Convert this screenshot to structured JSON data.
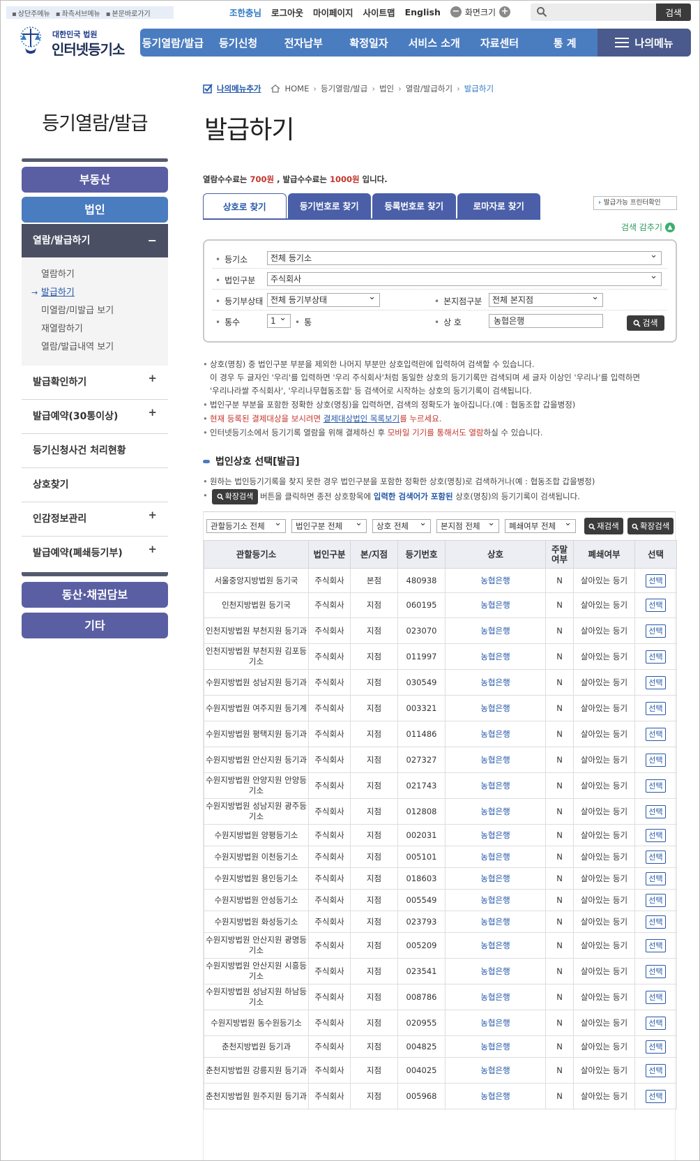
{
  "skipnav": [
    "상단주메뉴",
    "좌측서브메뉴",
    "본문바로가기"
  ],
  "util": {
    "user": "조한충님",
    "logout": "로그아웃",
    "mypage": "마이페이지",
    "sitemap": "사이트맵",
    "english": "English",
    "zoom": "화면크기",
    "search_btn": "검색"
  },
  "logo": {
    "sub": "대한민국 법원",
    "main": "인터넷등기소"
  },
  "gnb": [
    "등기열람/발급",
    "등기신청",
    "전자납부",
    "확정일자",
    "서비스 소개",
    "자료센터",
    "통 계"
  ],
  "mymenu": "나의메뉴",
  "breadcrumb": {
    "add": "나의메뉴추가",
    "items": [
      "HOME",
      "등기열람/발급",
      "법인",
      "열람/발급하기",
      "발급하기"
    ]
  },
  "page_title": "발급하기",
  "lnb": {
    "title": "등기열람/발급",
    "top_buttons": [
      "부동산",
      "법인"
    ],
    "sub_title": "열람/발급하기",
    "sub_items": [
      "열람하기",
      "발급하기",
      "미열람/미발급 보기",
      "재열람하기",
      "열람/발급내역 보기"
    ],
    "menus": [
      {
        "label": "발급확인하기",
        "expand": "+"
      },
      {
        "label": "발급예약(30통이상)",
        "expand": "+"
      },
      {
        "label": "등기신청사건 처리현황",
        "expand": ""
      },
      {
        "label": "상호찾기",
        "expand": ""
      },
      {
        "label": "인감정보관리",
        "expand": "+"
      },
      {
        "label": "발급예약(폐쇄등기부)",
        "expand": "+"
      }
    ],
    "bottom_buttons": [
      "동산·채권담보",
      "기타"
    ]
  },
  "fee": {
    "prefix": "열람수수료는 ",
    "view_fee": "700원",
    "mid": " , 발급수수료는 ",
    "issue_fee": "1000원",
    "suffix": " 입니다."
  },
  "tabs": [
    "상호로 찾기",
    "등기번호로 찾기",
    "등록번호로 찾기",
    "로마자로 찾기"
  ],
  "print_check": "발급가능 프린터확인",
  "fold": "검색 감추기",
  "search": {
    "registry_label": "등기소",
    "registry_value": "전체 등기소",
    "corp_type_label": "법인구분",
    "corp_type_value": "주식회사",
    "status_label": "등기부상태",
    "status_value": "전체 등기부상태",
    "branch_label": "본지점구분",
    "branch_value": "전체 본지점",
    "copies_label": "통수",
    "copies_value": "1",
    "copies_unit": "통",
    "name_label": "상 호",
    "name_value": "농협은행",
    "go": "검색"
  },
  "notes": {
    "n1a": "상호(명칭) 중 법인구분 부분을 제외한 나머지 부분만 상호입력란에 입력하여 검색할 수 있습니다.",
    "n1b": "이 경우 두 글자인 '우리'를 입력하면 '우리 주식회사'처럼 동일한 상호의 등기기록만 검색되며 세 글자 이상인 '우리나'를 입력하면",
    "n1c": "'우리나라쌀 주식회사', '우리나무협동조합' 등 검색어로 시작하는 상호의 등기기록이 검색됩니다.",
    "n2": "법인구분 부분을 포함한 정확한 상호(명칭)을 입력하면, 검색의 정확도가 높아집니다.(예 : 협동조합 갑을병정)",
    "n3a": "현재 등록된 결제대상을 보시려면 ",
    "n3b": "결제대상법인 목록보기",
    "n3c": "를 누르세요.",
    "n4a": "인터넷등기소에서 등기기록 열람을 위해 결제하신 후 ",
    "n4b": "모바일 기기를 통해서도 열람",
    "n4c": "하실 수 있습니다."
  },
  "section_title": "법인상호 선택[발급]",
  "notes2": {
    "m1": "원하는 법인등기기록을 찾지 못한 경우 법인구분을 포함한 정확한 상호(명칭)로 검색하거나(예 : 협동조합 갑을병정)",
    "m2_btn": "확장검색",
    "m2a": "버튼을 클릭하면 종전 상호항목에 ",
    "m2b": "입력한 검색어가 포함된",
    "m2c": " 상호(명칭)의 등기기록이 검색됩니다."
  },
  "filters": [
    "관할등기소 전체",
    "법인구분 전체",
    "상호 전체",
    "본지점 전체",
    "폐쇄여부 전체"
  ],
  "filter_buttons": {
    "research": "재검색",
    "expand": "확장검색"
  },
  "table": {
    "headers": [
      "관할등기소",
      "법인구분",
      "본/지점",
      "등기번호",
      "상호",
      "주말\n여부",
      "폐쇄여부",
      "선택"
    ],
    "select_label": "선택",
    "rows": [
      [
        "서울중앙지방법원 등기국",
        "주식회사",
        "본점",
        "480938",
        "농협은행",
        "N",
        "살아있는 등기"
      ],
      [
        "인천지방법원 등기국",
        "주식회사",
        "지점",
        "060195",
        "농협은행",
        "N",
        "살아있는 등기"
      ],
      [
        "인천지방법원 부천지원 등기과",
        "주식회사",
        "지점",
        "023070",
        "농협은행",
        "N",
        "살아있는 등기"
      ],
      [
        "인천지방법원 부천지원 김포등기소",
        "주식회사",
        "지점",
        "011997",
        "농협은행",
        "N",
        "살아있는 등기"
      ],
      [
        "수원지방법원 성남지원 등기과",
        "주식회사",
        "지점",
        "030549",
        "농협은행",
        "N",
        "살아있는 등기"
      ],
      [
        "수원지방법원 여주지원 등기계",
        "주식회사",
        "지점",
        "003321",
        "농협은행",
        "N",
        "살아있는 등기"
      ],
      [
        "수원지방법원 평택지원 등기과",
        "주식회사",
        "지점",
        "011486",
        "농협은행",
        "N",
        "살아있는 등기"
      ],
      [
        "수원지방법원 안산지원 등기과",
        "주식회사",
        "지점",
        "027327",
        "농협은행",
        "N",
        "살아있는 등기"
      ],
      [
        "수원지방법원 안양지원 안양등기소",
        "주식회사",
        "지점",
        "021743",
        "농협은행",
        "N",
        "살아있는 등기"
      ],
      [
        "수원지방법원 성남지원 광주등기소",
        "주식회사",
        "지점",
        "012808",
        "농협은행",
        "N",
        "살아있는 등기"
      ],
      [
        "수원지방법원 양평등기소",
        "주식회사",
        "지점",
        "002031",
        "농협은행",
        "N",
        "살아있는 등기"
      ],
      [
        "수원지방법원 이천등기소",
        "주식회사",
        "지점",
        "005101",
        "농협은행",
        "N",
        "살아있는 등기"
      ],
      [
        "수원지방법원 용인등기소",
        "주식회사",
        "지점",
        "018603",
        "농협은행",
        "N",
        "살아있는 등기"
      ],
      [
        "수원지방법원 안성등기소",
        "주식회사",
        "지점",
        "005549",
        "농협은행",
        "N",
        "살아있는 등기"
      ],
      [
        "수원지방법원 화성등기소",
        "주식회사",
        "지점",
        "023793",
        "농협은행",
        "N",
        "살아있는 등기"
      ],
      [
        "수원지방법원 안산지원 광명등기소",
        "주식회사",
        "지점",
        "005209",
        "농협은행",
        "N",
        "살아있는 등기"
      ],
      [
        "수원지방법원 안산지원 시흥등기소",
        "주식회사",
        "지점",
        "023541",
        "농협은행",
        "N",
        "살아있는 등기"
      ],
      [
        "수원지방법원 성남지원 하남등기소",
        "주식회사",
        "지점",
        "008786",
        "농협은행",
        "N",
        "살아있는 등기"
      ],
      [
        "수원지방법원 동수원등기소",
        "주식회사",
        "지점",
        "020955",
        "농협은행",
        "N",
        "살아있는 등기"
      ],
      [
        "춘천지방법원 등기과",
        "주식회사",
        "지점",
        "004825",
        "농협은행",
        "N",
        "살아있는 등기"
      ],
      [
        "춘천지방법원 강릉지원 등기과",
        "주식회사",
        "지점",
        "004025",
        "농협은행",
        "N",
        "살아있는 등기"
      ],
      [
        "춘천지방법원 원주지원 등기과",
        "주식회사",
        "지점",
        "005968",
        "농협은행",
        "N",
        "살아있는 등기"
      ]
    ]
  },
  "colors": {
    "primary": "#4a7cc0",
    "lnb_purple": "#5a5fa3",
    "dark": "#3b3b3b",
    "accent_red": "#c3342b",
    "link_blue": "#2457a8"
  }
}
